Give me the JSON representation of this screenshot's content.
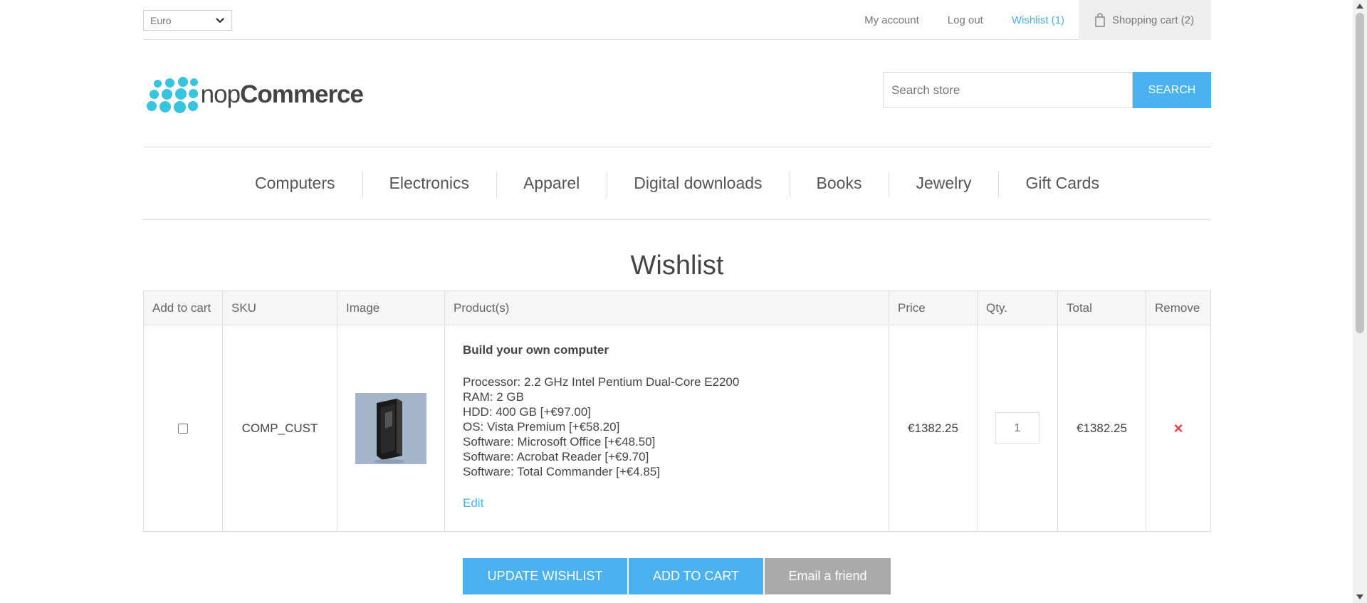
{
  "header": {
    "currency": "Euro",
    "my_account": "My account",
    "logout": "Log out",
    "wishlist": "Wishlist (1)",
    "cart": "Shopping cart (2)"
  },
  "logo": {
    "text_light": "nop",
    "text_bold": "Commerce"
  },
  "search": {
    "placeholder": "Search store",
    "button": "SEARCH"
  },
  "nav": [
    "Computers",
    "Electronics",
    "Apparel",
    "Digital downloads",
    "Books",
    "Jewelry",
    "Gift Cards"
  ],
  "page_title": "Wishlist",
  "table": {
    "headers": [
      "Add to cart",
      "SKU",
      "Image",
      "Product(s)",
      "Price",
      "Qty.",
      "Total",
      "Remove"
    ],
    "row": {
      "sku": "COMP_CUST",
      "name": "Build your own computer",
      "attributes": [
        "Processor: 2.2 GHz Intel Pentium Dual-Core E2200",
        "RAM: 2 GB",
        "HDD: 400 GB [+€97.00]",
        "OS: Vista Premium [+€58.20]",
        "Software: Microsoft Office [+€48.50]",
        "Software: Acrobat Reader [+€9.70]",
        "Software: Total Commander [+€4.85]"
      ],
      "edit": "Edit",
      "price": "€1382.25",
      "qty": "1",
      "total": "€1382.25",
      "remove_symbol": "×"
    }
  },
  "buttons": {
    "update": "UPDATE WISHLIST",
    "add_to_cart": "ADD TO CART",
    "email": "Email a friend"
  },
  "colors": {
    "accent": "#4ab2f1",
    "remove": "#e4434b",
    "logo": "#37c4de"
  }
}
